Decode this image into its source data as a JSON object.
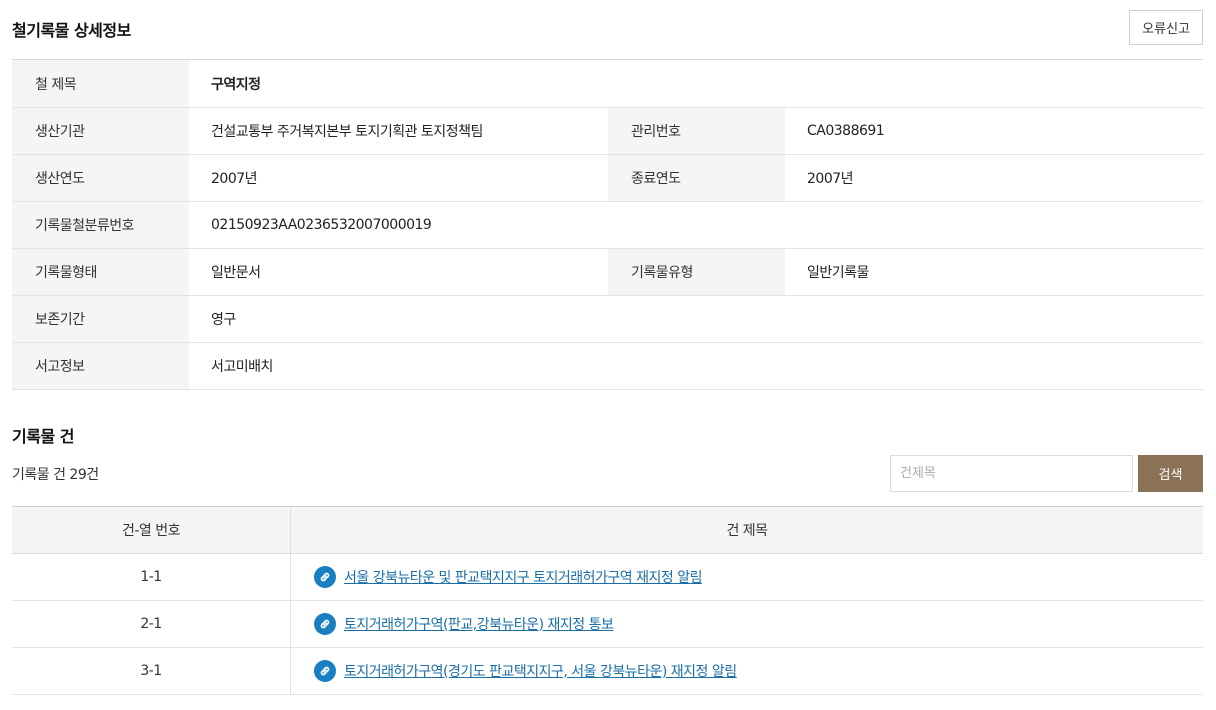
{
  "header": {
    "title": "철기록물 상세정보",
    "report_button": "오류신고"
  },
  "info": {
    "title_label": "철 제목",
    "title_value": "구역지정",
    "producer_label": "생산기관",
    "producer_value": "건설교통부 주거복지본부 토지기획관 토지정책팀",
    "mgmt_no_label": "관리번호",
    "mgmt_no_value": "CA0388691",
    "prod_year_label": "생산연도",
    "prod_year_value": "2007년",
    "end_year_label": "종료연도",
    "end_year_value": "2007년",
    "class_no_label": "기록물철분류번호",
    "class_no_value": "02150923AA0236532007000019",
    "form_label": "기록물형태",
    "form_value": "일반문서",
    "type_label": "기록물유형",
    "type_value": "일반기록물",
    "retention_label": "보존기간",
    "retention_value": "영구",
    "shelf_label": "서고정보",
    "shelf_value": "서고미배치"
  },
  "records": {
    "title": "기록물 건",
    "count_text": "기록물 건 29건",
    "search_placeholder": "건제목",
    "search_button": "검색",
    "col_no": "건-열 번호",
    "col_title": "건 제목",
    "rows": [
      {
        "no": "1-1",
        "title": "서울 강북뉴타운 및 판교택지지구 토지거래허가구역 재지정 알림"
      },
      {
        "no": "2-1",
        "title": "토지거래허가구역(판교,강북뉴타운) 재지정 통보"
      },
      {
        "no": "3-1",
        "title": "토지거래허가구역(경기도 판교택지지구, 서울 강북뉴타운) 재지정 알림"
      }
    ]
  },
  "colors": {
    "search_button_bg": "#8b7156",
    "link_color": "#1a6fa8",
    "link_icon_bg": "#1a7fc1"
  },
  "icons": {
    "record_link": "link-icon"
  }
}
